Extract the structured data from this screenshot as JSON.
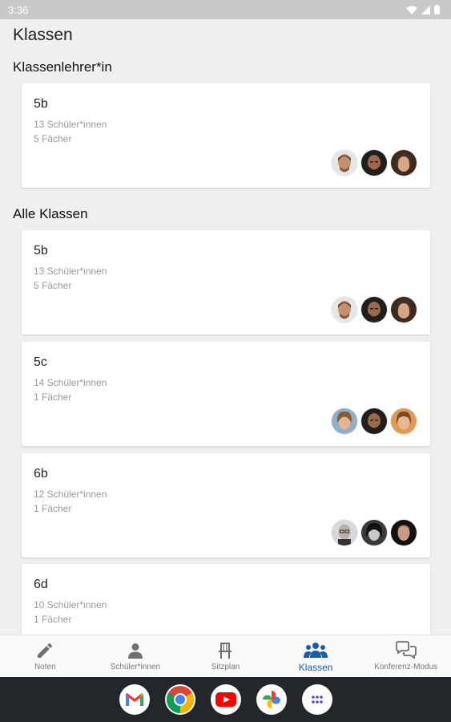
{
  "status_bar": {
    "time": "3:36"
  },
  "page": {
    "title": "Klassen",
    "section_teacher": "Klassenlehrer*in",
    "section_all": "Alle Klassen"
  },
  "teacher_classes": [
    {
      "name": "5b",
      "students": "13 Schüler*innen",
      "subjects": "5 Fächer"
    }
  ],
  "all_classes": [
    {
      "name": "5b",
      "students": "13 Schüler*innen",
      "subjects": "5 Fächer"
    },
    {
      "name": "5c",
      "students": "14 Schüler*innen",
      "subjects": "1 Fächer"
    },
    {
      "name": "6b",
      "students": "12 Schüler*innen",
      "subjects": "1 Fächer"
    },
    {
      "name": "6d",
      "students": "10 Schüler*innen",
      "subjects": "1 Fächer"
    }
  ],
  "bottom_nav": {
    "items": [
      {
        "label": "Noten",
        "icon": "pencil-icon"
      },
      {
        "label": "Schüler*innen",
        "icon": "person-icon"
      },
      {
        "label": "Sitzplan",
        "icon": "chair-icon"
      },
      {
        "label": "Klassen",
        "icon": "group-icon",
        "active": true
      },
      {
        "label": "Konferenz-Modus",
        "icon": "chat-bubbles-icon"
      }
    ]
  },
  "dock": {
    "apps": [
      "gmail-icon",
      "chrome-icon",
      "youtube-icon",
      "photos-icon",
      "app-drawer-icon"
    ]
  },
  "colors": {
    "accent": "#1a5ea8",
    "background": "#efefef",
    "status_bar": "#c9c9c9",
    "system_bar": "#23262a"
  }
}
